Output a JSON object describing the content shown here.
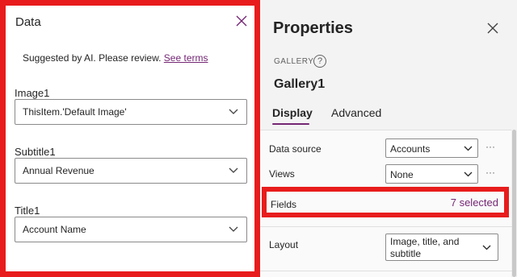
{
  "data_panel": {
    "title": "Data",
    "ai_note": "Suggested by AI. Please review.",
    "see_terms": "See terms",
    "fields": [
      {
        "label": "Image1",
        "value": "ThisItem.'Default Image'"
      },
      {
        "label": "Subtitle1",
        "value": "Annual Revenue"
      },
      {
        "label": "Title1",
        "value": "Account Name"
      }
    ],
    "icons": {
      "close": "close-icon",
      "dropdown": "chevron-down-icon"
    }
  },
  "properties_panel": {
    "title": "Properties",
    "control_type": "GALLERY",
    "help_glyph": "?",
    "control_name": "Gallery1",
    "tabs": [
      {
        "label": "Display",
        "selected": true
      },
      {
        "label": "Advanced",
        "selected": false
      }
    ],
    "rows": {
      "data_source": {
        "label": "Data source",
        "value": "Accounts"
      },
      "views": {
        "label": "Views",
        "value": "None"
      },
      "fields": {
        "label": "Fields",
        "value": "7 selected"
      },
      "layout": {
        "label": "Layout",
        "value": "Image, title, and subtitle"
      }
    },
    "more_glyph": "···"
  },
  "colors": {
    "highlight": "#e81c1c",
    "accent": "#742774"
  }
}
